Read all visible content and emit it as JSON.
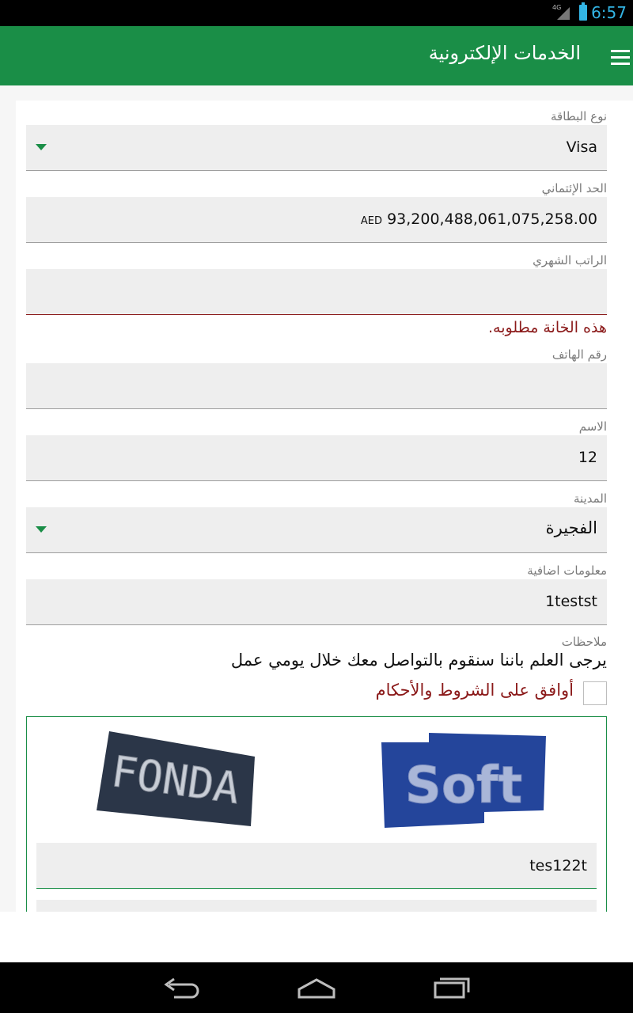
{
  "status_bar": {
    "network": "4G",
    "time": "6:57"
  },
  "app_bar": {
    "title": "الخدمات الإلكترونية",
    "menu_icon": "hamburger-menu-icon"
  },
  "form": {
    "card_type": {
      "label": "نوع البطاقة",
      "value": "Visa"
    },
    "credit_limit": {
      "label": "الحد الإئتماني",
      "currency": "AED",
      "value": "93,200,488,061,075,258.00"
    },
    "monthly_salary": {
      "label": "الراتب الشهري",
      "value": "",
      "error": "هذه الخانة مطلوبه."
    },
    "phone": {
      "label": "رقم الهاتف",
      "value": ""
    },
    "name": {
      "label": "الاسم",
      "value": "12"
    },
    "city": {
      "label": "المدينة",
      "value": "الفجيرة"
    },
    "additional_info": {
      "label": "معلومات اضافية",
      "value": "1testst"
    },
    "notes": {
      "label": "ملاحظات",
      "text": "يرجى العلم باننا سنقوم بالتواصل معك خلال يومي عمل"
    },
    "terms": {
      "label": "أوافق على الشروط والأحكام",
      "checked": false
    }
  },
  "captcha": {
    "word1": "FONDA",
    "word2": "Soft",
    "input_value": "tes122t"
  },
  "colors": {
    "primary": "#1a8e47",
    "error": "#8b1a1a",
    "status_accent": "#33b5e5"
  }
}
